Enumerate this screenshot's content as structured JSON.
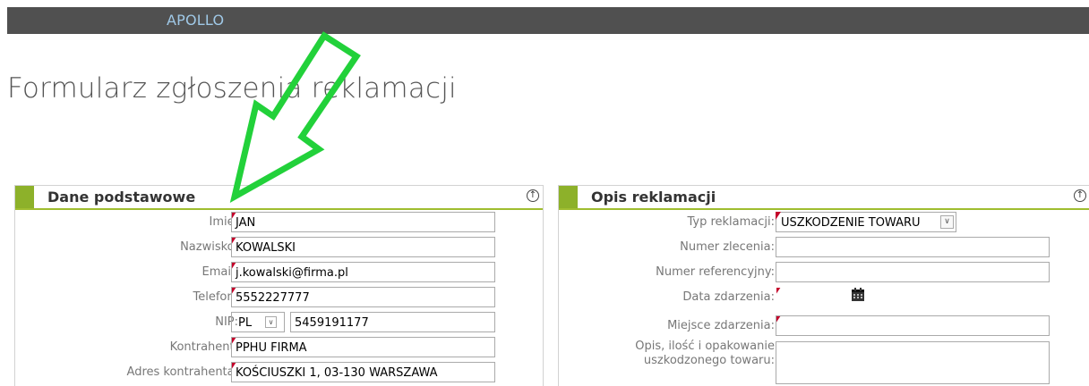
{
  "topbar": {
    "brand": "APOLLO"
  },
  "page": {
    "title": "Formularz zgłoszenia reklamacji"
  },
  "left_panel": {
    "title": "Dane podstawowe",
    "collapse_icon": "arrow-up-circle-icon",
    "fields": {
      "imie": {
        "label": "Imię:",
        "value": "JAN"
      },
      "nazwisko": {
        "label": "Nazwisko:",
        "value": "KOWALSKI"
      },
      "email": {
        "label": "Email:",
        "value": "j.kowalski@firma.pl"
      },
      "telefon": {
        "label": "Telefon:",
        "value": "5552227777"
      },
      "nip": {
        "label": "NIP:",
        "prefix": "PL",
        "value": "5459191177"
      },
      "kontrahent": {
        "label": "Kontrahent:",
        "value": "PPHU FIRMA"
      },
      "adres": {
        "label": "Adres kontrahenta:",
        "value": "KOŚCIUSZKI 1, 03-130 WARSZAWA"
      }
    }
  },
  "right_panel": {
    "title": "Opis reklamacji",
    "collapse_icon": "arrow-up-circle-icon",
    "fields": {
      "typ": {
        "label": "Typ reklamacji:",
        "value": "USZKODZENIE TOWARU"
      },
      "numer_zlecenia": {
        "label": "Numer zlecenia:",
        "value": ""
      },
      "numer_ref": {
        "label": "Numer referencyjny:",
        "value": ""
      },
      "data": {
        "label": "Data zdarzenia:",
        "value": ""
      },
      "miejsce": {
        "label": "Miejsce zdarzenia:",
        "value": ""
      },
      "opis": {
        "label_line1": "Opis, ilość i opakowanie",
        "label_line2": "uszkodzonego towaru:",
        "value": ""
      }
    }
  },
  "colors": {
    "topbar": "#505050",
    "brand": "#9fc8e6",
    "accent_green": "#8db12a",
    "required_marker": "#c4002a",
    "annotation_arrow": "#22d13a"
  },
  "annotation": {
    "icon": "green-arrow-annotation"
  }
}
